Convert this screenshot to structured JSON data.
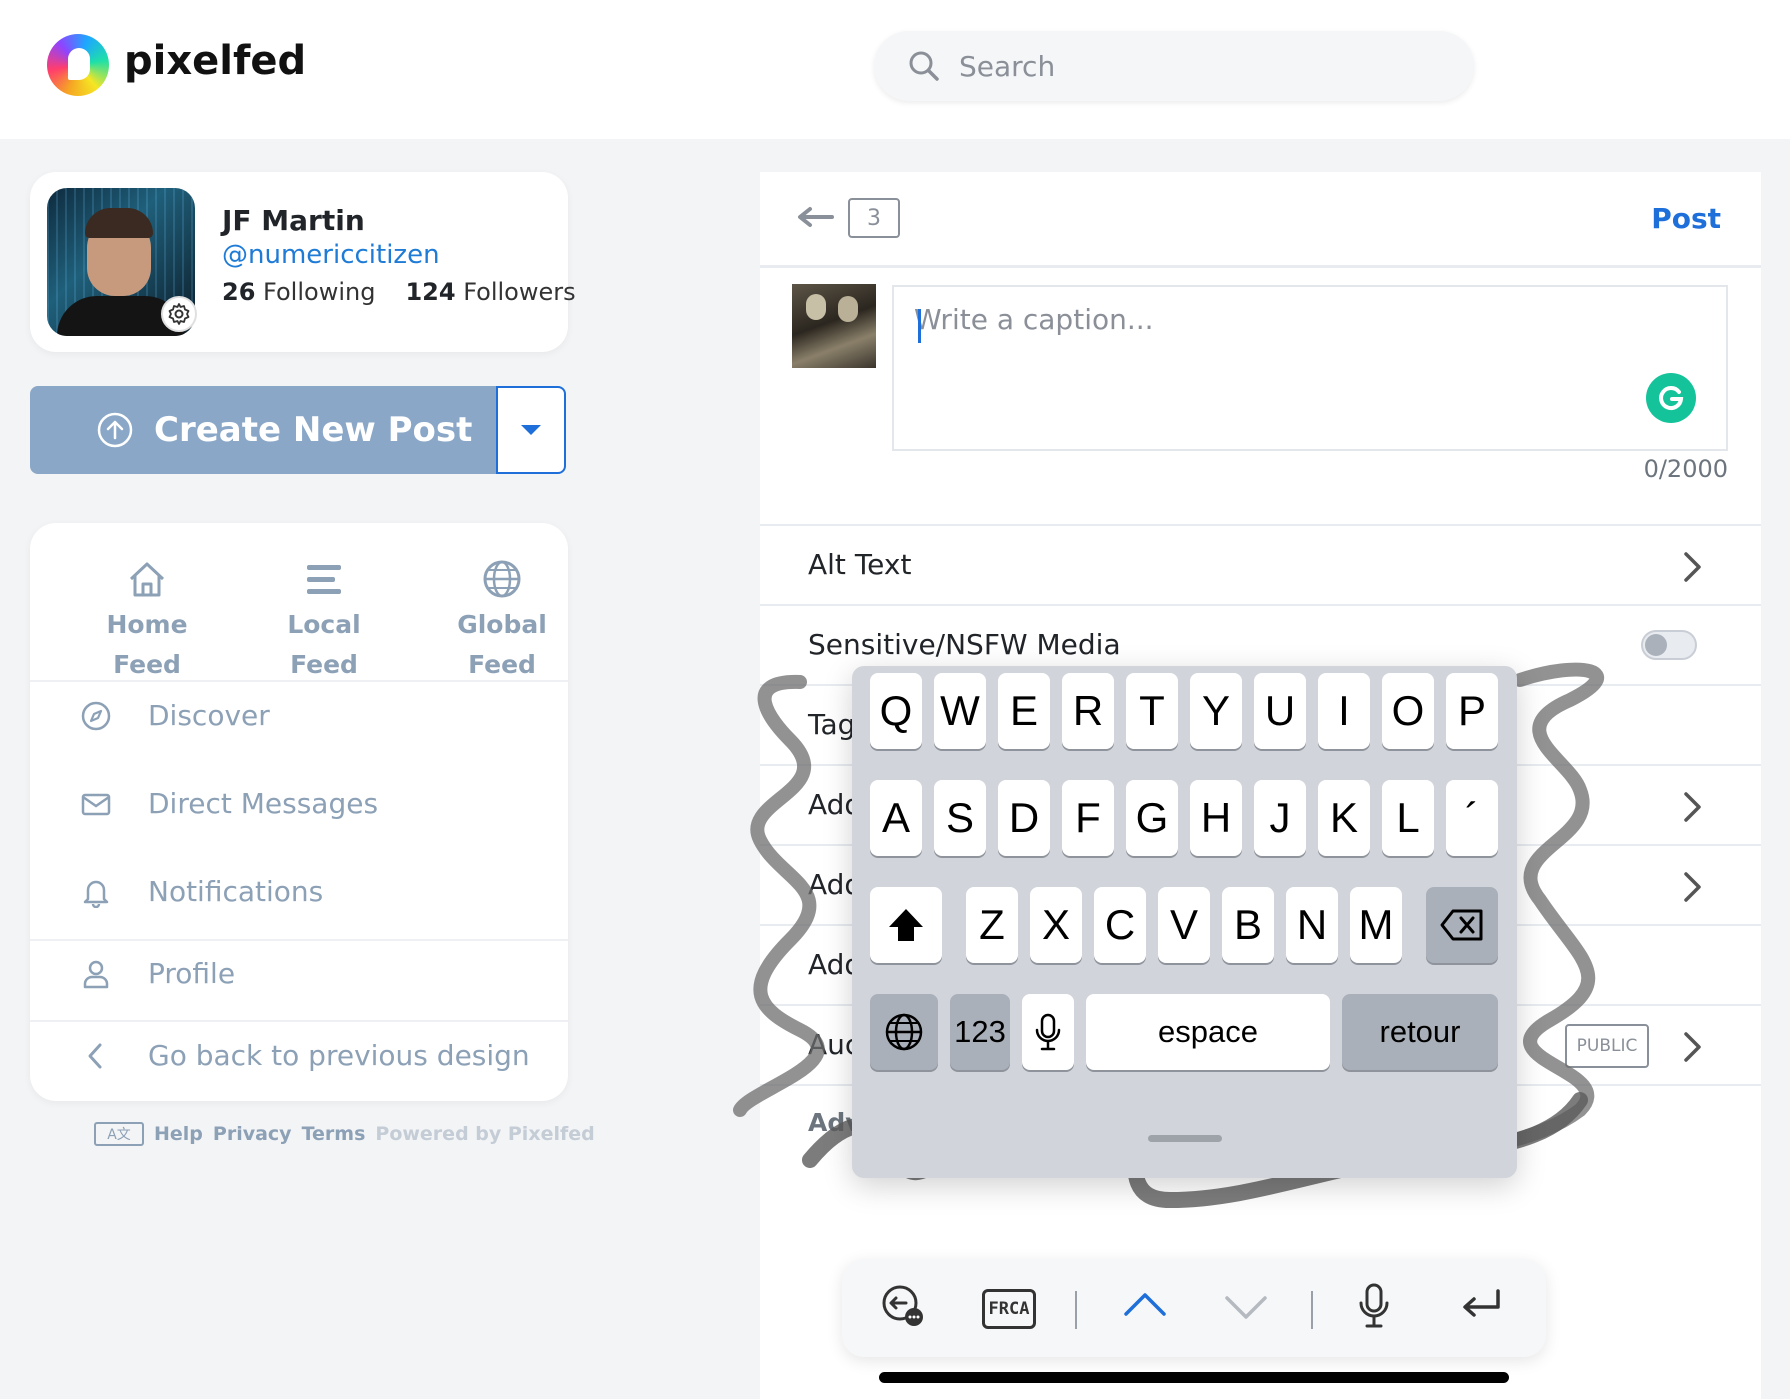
{
  "app": {
    "name": "pixelfed",
    "search_placeholder": "Search"
  },
  "profile": {
    "name": "JF Martin",
    "handle": "@numericcitizen",
    "following_count": "26",
    "following_label": "Following",
    "followers_count": "124",
    "followers_label": "Followers"
  },
  "create": {
    "label": "Create New Post"
  },
  "feeds": [
    {
      "line1": "Home",
      "line2": "Feed",
      "icon": "home-icon"
    },
    {
      "line1": "Local",
      "line2": "Feed",
      "icon": "local-feed-icon"
    },
    {
      "line1": "Global",
      "line2": "Feed",
      "icon": "globe-icon"
    }
  ],
  "nav": {
    "discover": "Discover",
    "messages": "Direct Messages",
    "notifications": "Notifications",
    "profile": "Profile",
    "previous": "Go back to previous design"
  },
  "footer": {
    "translate_icon": "translate-icon",
    "help": "Help",
    "privacy": "Privacy",
    "terms": "Terms",
    "powered": "Powered by Pixelfed"
  },
  "composer": {
    "media_count": "3",
    "post_label": "Post",
    "caption_placeholder": "Write a caption...",
    "char_count": "0/2000",
    "rows": {
      "alt_text": "Alt Text",
      "sensitive": "Sensitive/NSFW Media",
      "tag": "Tag",
      "add1": "Add",
      "add2": "Add",
      "add3": "Add",
      "audience": "Auc",
      "audience_badge": "PUBLIC",
      "advanced": "Adv"
    },
    "sensitive_on": false
  },
  "keyboard": {
    "row1": [
      "Q",
      "W",
      "E",
      "R",
      "T",
      "Y",
      "U",
      "I",
      "O",
      "P"
    ],
    "row2": [
      "A",
      "S",
      "D",
      "F",
      "G",
      "H",
      "J",
      "K",
      "L",
      "´"
    ],
    "row3": [
      "Z",
      "X",
      "C",
      "V",
      "B",
      "N",
      "M"
    ],
    "numbers": "123",
    "space": "espace",
    "return": "retour"
  },
  "kb_toolbar": {
    "layout_label": "FRCA"
  },
  "colors": {
    "accent": "#1e6fd9",
    "create_button": "#8aa7c8",
    "nav_text": "#8ca0b6"
  }
}
